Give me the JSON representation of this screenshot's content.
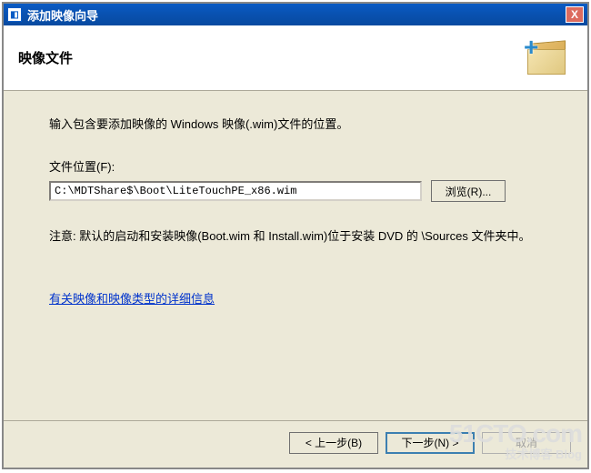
{
  "window": {
    "title": "添加映像向导",
    "close_label": "X"
  },
  "header": {
    "title": "映像文件"
  },
  "content": {
    "prompt": "输入包含要添加映像的 Windows 映像(.wim)文件的位置。",
    "file_location_label": "文件位置(F):",
    "file_path": "C:\\MDTShare$\\Boot\\LiteTouchPE_x86.wim",
    "browse_label": "浏览(R)...",
    "note_text": "注意: 默认的启动和安装映像(Boot.wim 和 Install.wim)位于安装 DVD 的 \\Sources 文件夹中。",
    "link_text": "有关映像和映像类型的详细信息"
  },
  "buttons": {
    "back": "< 上一步(B)",
    "next": "下一步(N) >",
    "cancel": "取消"
  },
  "watermark": {
    "line1": "51CTO.com",
    "line2": "技术博客  Blog"
  }
}
